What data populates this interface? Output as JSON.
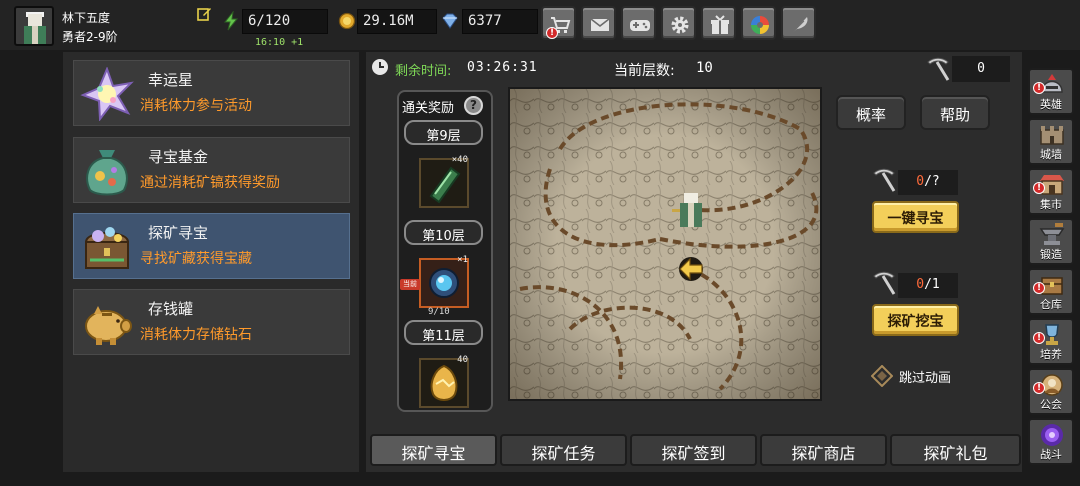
{
  "player": {
    "name": "林下五度",
    "rank": "勇者2-9阶"
  },
  "resources": {
    "energy": "6/120",
    "energy_timer": "16:10 +1",
    "gold": "29.16M",
    "gems": "6377"
  },
  "top_buttons": [
    {
      "name": "shop-cart",
      "alert": true
    },
    {
      "name": "mail",
      "alert": false
    },
    {
      "name": "gamepad",
      "alert": false
    },
    {
      "name": "settings-gear",
      "alert": false
    },
    {
      "name": "gift",
      "alert": false
    },
    {
      "name": "color-wheel",
      "alert": false
    },
    {
      "name": "feather",
      "alert": false
    }
  ],
  "menu": [
    {
      "title": "幸运星",
      "desc": "消耗体力参与活动",
      "active": false
    },
    {
      "title": "寻宝基金",
      "desc": "通过消耗矿镐获得奖励",
      "active": false
    },
    {
      "title": "探矿寻宝",
      "desc": "寻找矿藏获得宝藏",
      "active": true
    },
    {
      "title": "存钱罐",
      "desc": "消耗体力存储钻石",
      "active": false
    }
  ],
  "status": {
    "time_label": "剩余时间:",
    "time_value": "03:26:31",
    "floor_label": "当前层数:",
    "floor_value": "10",
    "pickaxe_count": "0"
  },
  "rewards": {
    "title": "通关奖励",
    "help": "?",
    "floors": [
      "第9层",
      "第10层",
      "第11层"
    ],
    "slots": [
      {
        "item": "green-crystal",
        "count": "×40"
      },
      {
        "item": "blue-orb",
        "count": "×1"
      },
      {
        "item": "golden-egg",
        "count": "40"
      }
    ],
    "current_tag": "当前",
    "progress": "9/10"
  },
  "controls": {
    "odds": "概率",
    "help": "帮助",
    "quick_counter_num": "0",
    "quick_counter_den": "/?",
    "quick_button": "一键寻宝",
    "dig_counter_num": "0",
    "dig_counter_den": "/1",
    "dig_button": "探矿挖宝",
    "skip_label": "跳过动画"
  },
  "tabs": [
    {
      "label": "探矿寻宝",
      "active": true
    },
    {
      "label": "探矿任务",
      "active": false
    },
    {
      "label": "探矿签到",
      "active": false
    },
    {
      "label": "探矿商店",
      "active": false
    },
    {
      "label": "探矿礼包",
      "active": false
    }
  ],
  "sidebar": [
    {
      "label": "英雄",
      "icon": "helmet",
      "alert": true
    },
    {
      "label": "城墙",
      "icon": "castle-wall",
      "alert": false
    },
    {
      "label": "集市",
      "icon": "market",
      "alert": true
    },
    {
      "label": "锻造",
      "icon": "anvil",
      "alert": false
    },
    {
      "label": "仓库",
      "icon": "warehouse",
      "alert": true
    },
    {
      "label": "培养",
      "icon": "trophy",
      "alert": true
    },
    {
      "label": "公会",
      "icon": "guild",
      "alert": true
    },
    {
      "label": "战斗",
      "icon": "portal",
      "alert": false
    }
  ],
  "colors": {
    "accent_gold": "#f3cf5a",
    "desc_orange": "#ff9a2b",
    "timer_green": "#7fd957",
    "active_menu": "#3f5470",
    "alert_red": "#d32a2a"
  }
}
